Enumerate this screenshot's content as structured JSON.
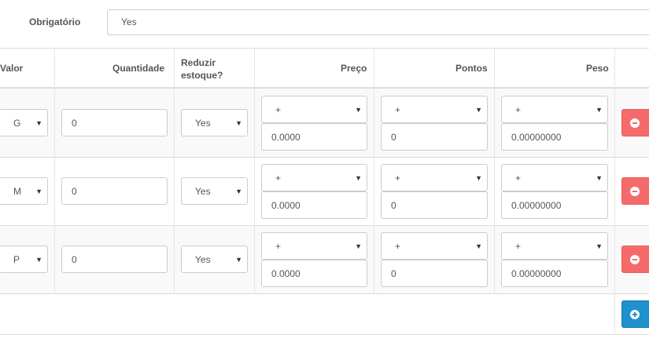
{
  "required": {
    "label": "Obrigatório",
    "value": "Yes"
  },
  "columns": {
    "valor": "Valor",
    "quantidade": "Quantidade",
    "reduzir_line1": "Reduzir",
    "reduzir_line2": "estoque?",
    "preco": "Preço",
    "pontos": "Pontos",
    "peso": "Peso"
  },
  "rows": [
    {
      "valor": "G",
      "quantidade": "0",
      "reduzir": "Yes",
      "preco_prefix": "+",
      "preco": "0.0000",
      "pontos_prefix": "+",
      "pontos": "0",
      "peso_prefix": "+",
      "peso": "0.00000000"
    },
    {
      "valor": "M",
      "quantidade": "0",
      "reduzir": "Yes",
      "preco_prefix": "+",
      "preco": "0.0000",
      "pontos_prefix": "+",
      "pontos": "0",
      "peso_prefix": "+",
      "peso": "0.00000000"
    },
    {
      "valor": "P",
      "quantidade": "0",
      "reduzir": "Yes",
      "preco_prefix": "+",
      "preco": "0.0000",
      "pontos_prefix": "+",
      "pontos": "0",
      "peso_prefix": "+",
      "peso": "0.00000000"
    }
  ],
  "icons": {
    "arrow": "▼",
    "remove": "minus-circle-icon",
    "add": "plus-circle-icon"
  },
  "colors": {
    "remove": "#f56b6b",
    "add": "#1e91cf"
  }
}
